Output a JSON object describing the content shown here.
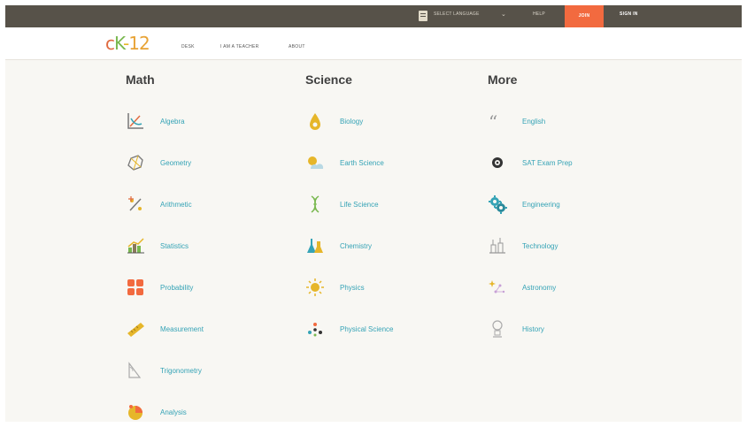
{
  "topbar": {
    "language_select": "SELECT LANGUAGE",
    "language_chevron": "⌄",
    "help": "HELP",
    "join": "JOIN",
    "sign_in": "SIGN IN"
  },
  "navbar": {
    "logo": {
      "c": "c",
      "k": "K",
      "dash": "-",
      "num": "12"
    },
    "links": [
      "DESK",
      "I AM A TEACHER",
      "ABOUT"
    ]
  },
  "columns": {
    "math": {
      "title": "Math",
      "items": [
        "Algebra",
        "Geometry",
        "Arithmetic",
        "Statistics",
        "Probability",
        "Measurement",
        "Trigonometry",
        "Analysis"
      ]
    },
    "science": {
      "title": "Science",
      "items": [
        "Biology",
        "Earth Science",
        "Life Science",
        "Chemistry",
        "Physics",
        "Physical Science"
      ]
    },
    "more": {
      "title": "More",
      "items": [
        "English",
        "SAT Exam Prep",
        "Engineering",
        "Technology",
        "Astronomy",
        "History"
      ]
    }
  },
  "colors": {
    "topbar": "#575249",
    "join": "#f26a3f",
    "link": "#35a3b6",
    "content_bg": "#f8f7f3"
  },
  "icons": {
    "math": [
      "algebra-icon",
      "geometry-icon",
      "arithmetic-icon",
      "statistics-icon",
      "probability-icon",
      "measurement-icon",
      "trigonometry-icon",
      "analysis-icon"
    ],
    "science": [
      "biology-icon",
      "earth-science-icon",
      "life-science-icon",
      "chemistry-icon",
      "physics-icon",
      "physical-science-icon"
    ],
    "more": [
      "english-icon",
      "sat-exam-prep-icon",
      "engineering-icon",
      "technology-icon",
      "astronomy-icon",
      "history-icon"
    ]
  }
}
